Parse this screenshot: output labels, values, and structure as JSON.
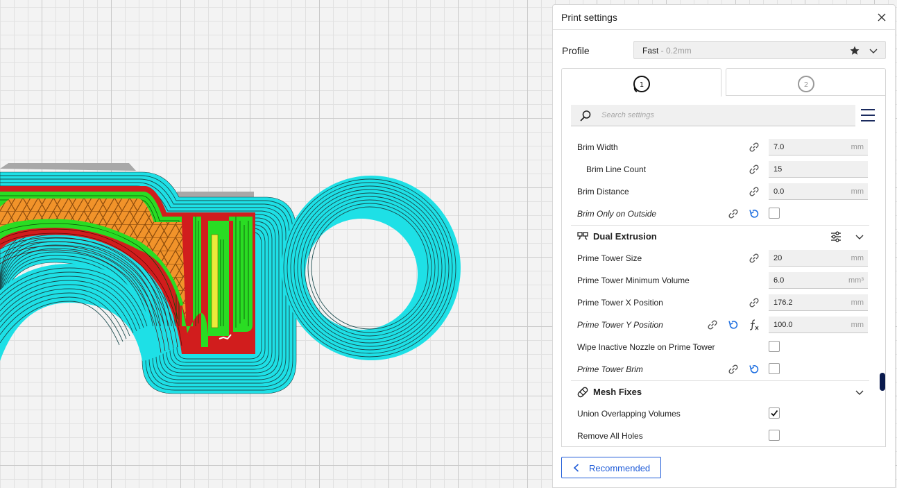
{
  "panel": {
    "title": "Print settings",
    "profile_label": "Profile",
    "profile_name": "Fast",
    "profile_sub": " - 0.2mm",
    "extruder_tabs": [
      {
        "label": "1",
        "active": true
      },
      {
        "label": "2",
        "active": false
      }
    ],
    "search_placeholder": "Search settings"
  },
  "settings": {
    "brim_width": {
      "label": "Brim Width",
      "value": "7.0",
      "unit": "mm"
    },
    "brim_line_count": {
      "label": "Brim Line Count",
      "value": "15"
    },
    "brim_distance": {
      "label": "Brim Distance",
      "value": "0.0",
      "unit": "mm"
    },
    "brim_only_outside": {
      "label": "Brim Only on Outside",
      "checked": false
    },
    "dual_extrusion": {
      "label": "Dual Extrusion"
    },
    "prime_tower_size": {
      "label": "Prime Tower Size",
      "value": "20",
      "unit": "mm"
    },
    "prime_tower_min_volume": {
      "label": "Prime Tower Minimum Volume",
      "value": "6.0",
      "unit": "mm³"
    },
    "prime_tower_x": {
      "label": "Prime Tower X Position",
      "value": "176.2",
      "unit": "mm"
    },
    "prime_tower_y": {
      "label": "Prime Tower Y Position",
      "value": "100.0",
      "unit": "mm"
    },
    "wipe_inactive": {
      "label": "Wipe Inactive Nozzle on Prime Tower",
      "checked": false
    },
    "prime_tower_brim": {
      "label": "Prime Tower Brim",
      "checked": false
    },
    "mesh_fixes": {
      "label": "Mesh Fixes"
    },
    "union_overlapping": {
      "label": "Union Overlapping Volumes",
      "checked": true
    },
    "remove_all_holes": {
      "label": "Remove All Holes",
      "checked": false
    }
  },
  "footer": {
    "recommended_label": "Recommended"
  },
  "colors": {
    "accent": "#1e5bd8",
    "reset_blue": "#1e6fe0",
    "wall_outer": "#1ee0e6",
    "wall_inner": "#2adc23",
    "wall_red": "#d11d1d",
    "infill": "#f1932a",
    "scroll_thumb": "#0a1a4d"
  }
}
